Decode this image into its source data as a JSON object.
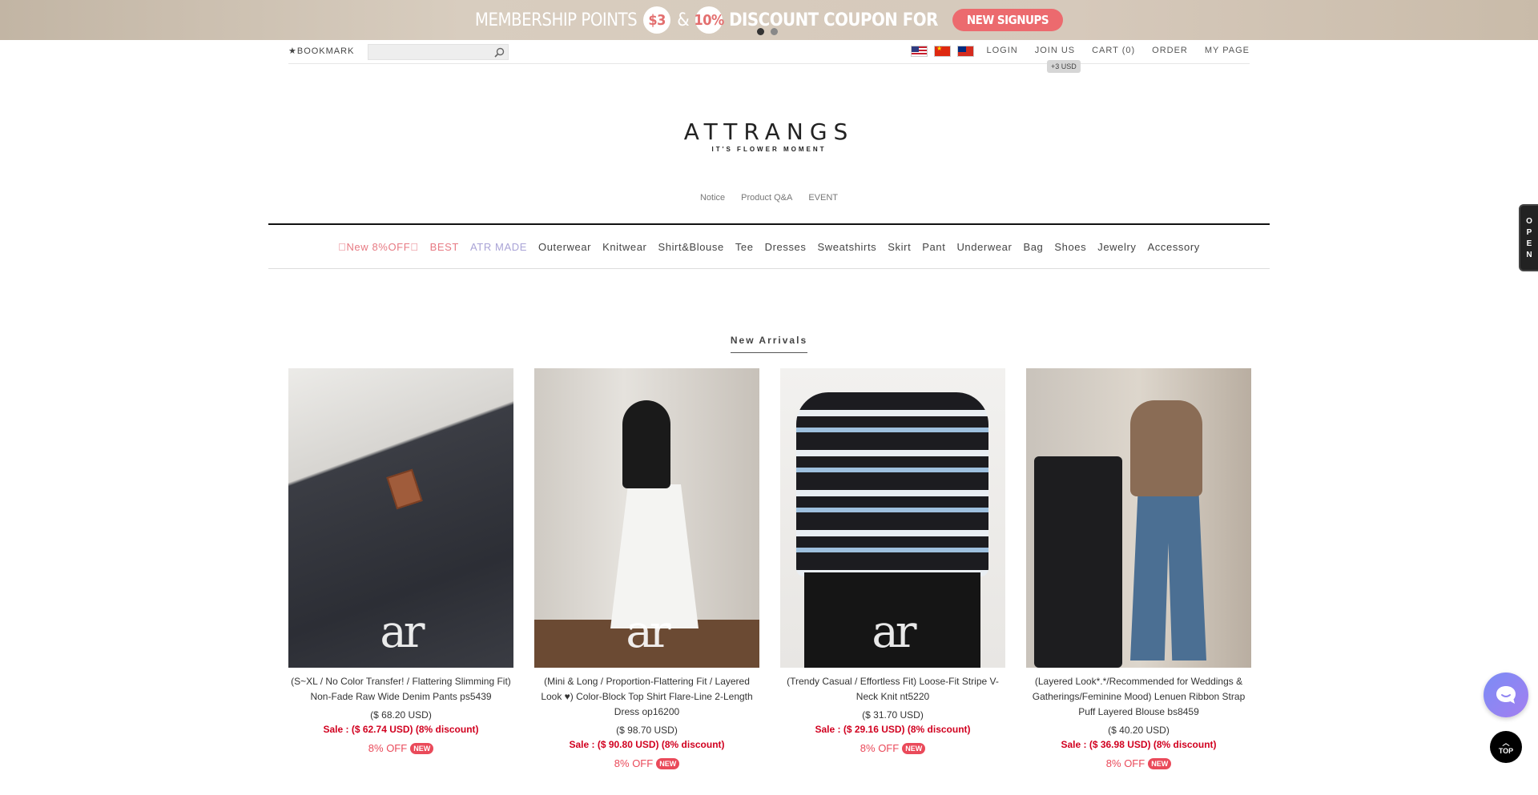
{
  "banner": {
    "text_membership": "MEMBERSHIP POINTS",
    "amount1": "$3",
    "amp": "&",
    "amount2": "10%",
    "text_discount": "DISCOUNT COUPON FOR",
    "signup_button": "NEW SIGNUPS"
  },
  "topbar": {
    "bookmark": "★BOOKMARK",
    "search_value": "",
    "links": [
      "LOGIN",
      "JOIN US",
      "CART (0)",
      "ORDER",
      "MY PAGE"
    ],
    "tooltip": "+3 USD"
  },
  "logo": {
    "main": "ATTRANGS",
    "sub": "IT'S FLOWER MOMENT"
  },
  "sublinks": [
    "Notice",
    "Product Q&A",
    "EVENT"
  ],
  "categories": {
    "new": "\u0000New 8%OFF\u0000",
    "best": "BEST",
    "atr": "ATR MADE",
    "items": [
      "Outerwear",
      "Knitwear",
      "Shirt&Blouse",
      "Tee",
      "Dresses",
      "Sweatshirts",
      "Skirt",
      "Pant",
      "Underwear",
      "Bag",
      "Shoes",
      "Jewelry",
      "Accessory"
    ]
  },
  "section_title": "New Arrivals",
  "products": [
    {
      "name": "(S~XL / No Color Transfer! / Flattering Slimming Fit) Non-Fade Raw Wide Denim Pants ps5439",
      "price": "($ 68.20 USD)",
      "sale_label": "Sale",
      "sale_value": ": ($ 62.74 USD) (8% discount)",
      "off": "8% OFF",
      "badge": "NEW",
      "watermark": "ar"
    },
    {
      "name": "(Mini & Long / Proportion-Flattering Fit / Layered Look ♥) Color-Block Top Shirt Flare-Line 2-Length Dress op16200",
      "price": "($ 98.70 USD)",
      "sale_label": "Sale",
      "sale_value": ": ($ 90.80 USD) (8% discount)",
      "off": "8% OFF",
      "badge": "NEW",
      "watermark": "ar"
    },
    {
      "name": "(Trendy Casual / Effortless Fit) Loose-Fit Stripe V-Neck Knit nt5220",
      "price": "($ 31.70 USD)",
      "sale_label": "Sale",
      "sale_value": ": ($ 29.16 USD) (8% discount)",
      "off": "8% OFF",
      "badge": "NEW",
      "watermark": "ar"
    },
    {
      "name": "(Layered Look*.*/Recommended for Weddings & Gatherings/Feminine Mood) Lenuen Ribbon Strap Puff Layered Blouse bs8459",
      "price": "($ 40.20 USD)",
      "sale_label": "Sale",
      "sale_value": ": ($ 36.98 USD) (8% discount)",
      "off": "8% OFF",
      "badge": "NEW",
      "watermark": ""
    }
  ],
  "side": {
    "open_letters": [
      "O",
      "P",
      "E",
      "N"
    ],
    "top_label": "TOP",
    "top_arrow": "︿"
  },
  "colors": {
    "accent_pink": "#ea4a5a",
    "sale_red": "#d1001f",
    "lavender": "#a9a3d6"
  },
  "icons": [
    "search-icon",
    "flag-us-icon",
    "flag-cn-icon",
    "flag-tw-icon",
    "chat-icon",
    "arrow-up-icon"
  ]
}
